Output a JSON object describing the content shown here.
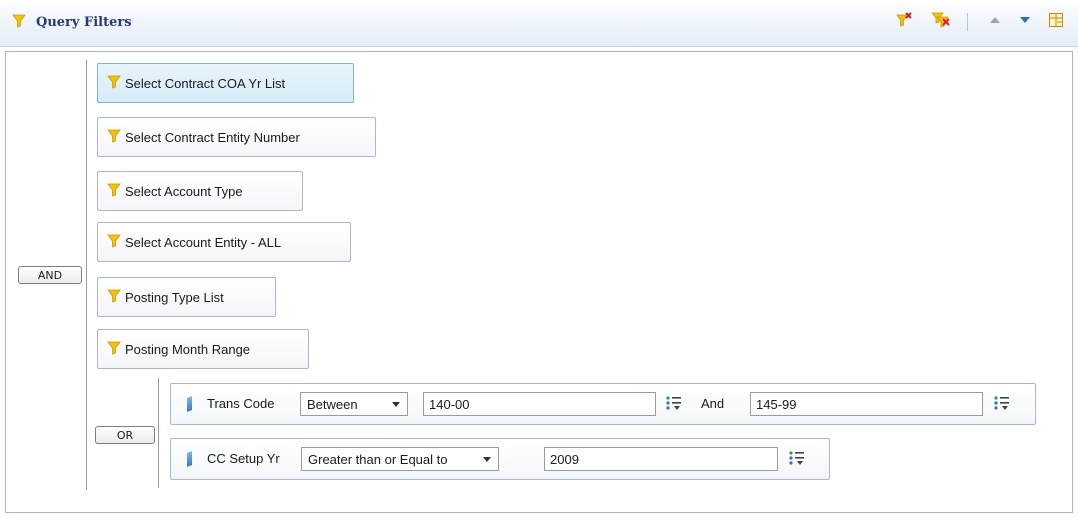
{
  "header": {
    "title": "Query Filters",
    "icons": [
      "funnel-icon",
      "remove-filter-icon",
      "clear-all-filters-icon",
      "move-up-icon",
      "move-down-icon",
      "layout-icon"
    ]
  },
  "logic": {
    "and_label": "AND",
    "or_label": "OR"
  },
  "filters": [
    {
      "label": "Select Contract COA Yr List",
      "selected": true
    },
    {
      "label": "Select Contract Entity Number",
      "selected": false
    },
    {
      "label": "Select Account Type",
      "selected": false
    },
    {
      "label": "Select Account Entity - ALL",
      "selected": false
    },
    {
      "label": "Posting Type List",
      "selected": false
    },
    {
      "label": "Posting Month Range",
      "selected": false
    }
  ],
  "conditions": [
    {
      "field": "Trans Code",
      "operator": "Between",
      "value1": "140-00",
      "joiner": "And",
      "value2": "145-99"
    },
    {
      "field": "CC Setup Yr",
      "operator": "Greater than or Equal to",
      "value1": "2009"
    }
  ],
  "colors": {
    "title": "#1f3b78",
    "funnel_yellow": "#f5c400",
    "selected_bg": "#d6ebf8",
    "border": "#a9b8cc"
  }
}
